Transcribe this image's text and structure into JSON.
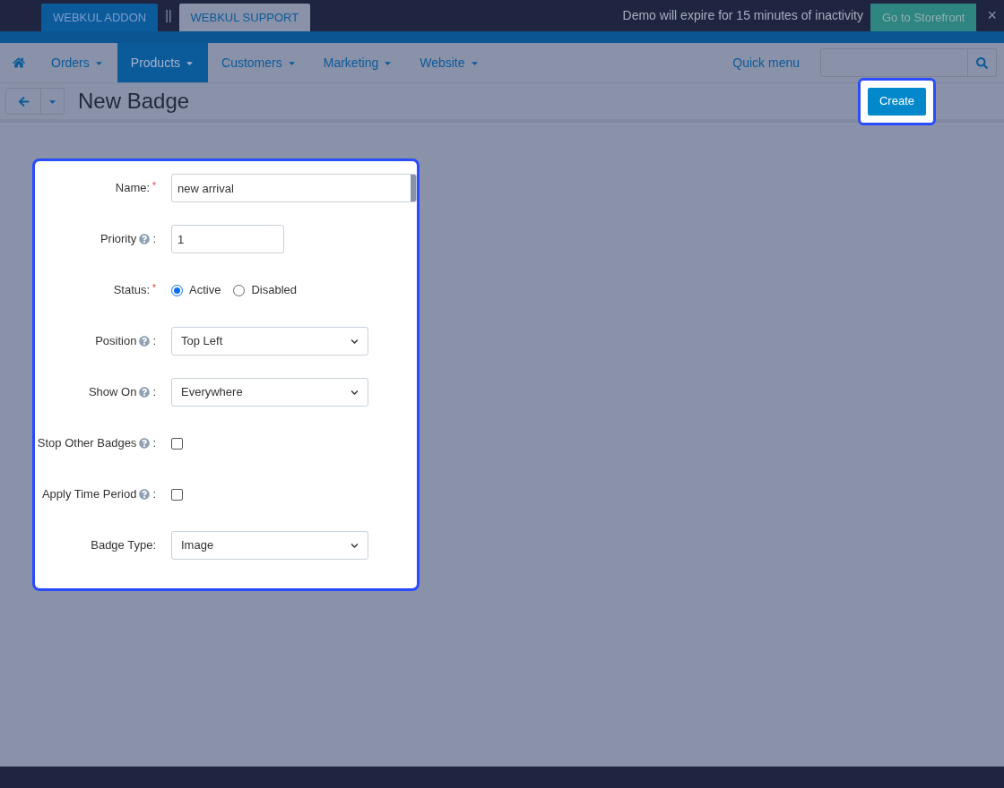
{
  "top_bar": {
    "buttons": [
      {
        "label": "WEBKUL ADDON",
        "kind": "primary"
      },
      {
        "label": "WEBKUL SUPPORT",
        "kind": "light"
      }
    ],
    "separator": "||",
    "notice": "Demo will expire for 15 minutes of inactivity",
    "storefront_button": "Go to Storefront",
    "close": "×"
  },
  "nav": {
    "items": [
      {
        "label": "Orders",
        "selected": false
      },
      {
        "label": "Products",
        "selected": true
      },
      {
        "label": "Customers",
        "selected": false
      },
      {
        "label": "Marketing",
        "selected": false
      },
      {
        "label": "Website",
        "selected": false
      }
    ],
    "quick_menu": "Quick menu"
  },
  "title": "New Badge",
  "create_button": "Create",
  "form": {
    "fields": [
      {
        "label": "Name:",
        "kind": "text",
        "required_mark": "*",
        "help": false,
        "value": "new arrival",
        "wide": true
      },
      {
        "label": "Priority",
        "kind": "text",
        "help": true,
        "suffix": ":",
        "value": "1",
        "wide": false
      },
      {
        "label": "Status:",
        "kind": "radio",
        "required_mark": "*",
        "help": false,
        "options": [
          {
            "label": "Active",
            "selected": true
          },
          {
            "label": "Disabled",
            "selected": false
          }
        ]
      },
      {
        "label": "Position",
        "kind": "select",
        "help": true,
        "suffix": ":",
        "value": "Top Left"
      },
      {
        "label": "Show On",
        "kind": "select",
        "help": true,
        "suffix": ":",
        "value": "Everywhere"
      },
      {
        "label": "Stop Other Badges",
        "kind": "checkbox",
        "help": true,
        "suffix": ":",
        "checked": false
      },
      {
        "label": "Apply Time Period",
        "kind": "checkbox",
        "help": true,
        "suffix": ":",
        "checked": false
      },
      {
        "label": "Badge Type:",
        "kind": "select",
        "help": false,
        "value": "Image"
      }
    ]
  }
}
